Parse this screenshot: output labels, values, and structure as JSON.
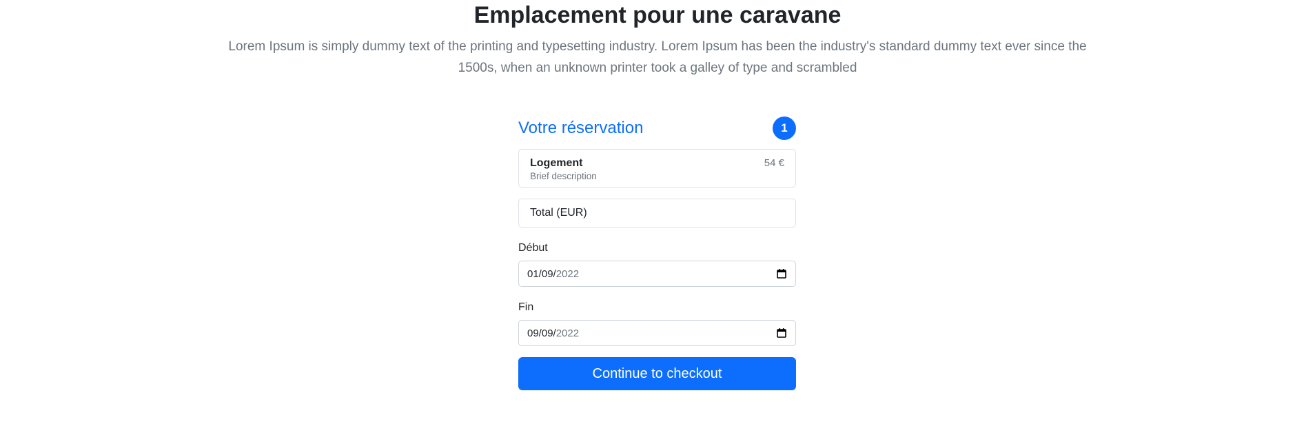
{
  "header": {
    "title": "Emplacement pour une caravane",
    "lead": "Lorem Ipsum is simply dummy text of the printing and typesetting industry. Lorem Ipsum has been the industry's standard dummy text ever since the 1500s, when an unknown printer took a galley of type and scrambled"
  },
  "reservation": {
    "heading": "Votre réservation",
    "count": "1",
    "item": {
      "title": "Logement",
      "description": "Brief description",
      "price": "54 €"
    },
    "total_label": "Total (EUR)",
    "start": {
      "label": "Début",
      "value_day_month": "01/09/",
      "value_year": "2022"
    },
    "end": {
      "label": "Fin",
      "value_day_month": "09/09/",
      "value_year": "2022"
    },
    "checkout_label": "Continue to checkout"
  },
  "icons": {
    "calendar": "calendar-icon"
  },
  "colors": {
    "primary": "#0d6efd",
    "text": "#212529",
    "muted": "#6c757d",
    "border": "#dee2e6"
  }
}
